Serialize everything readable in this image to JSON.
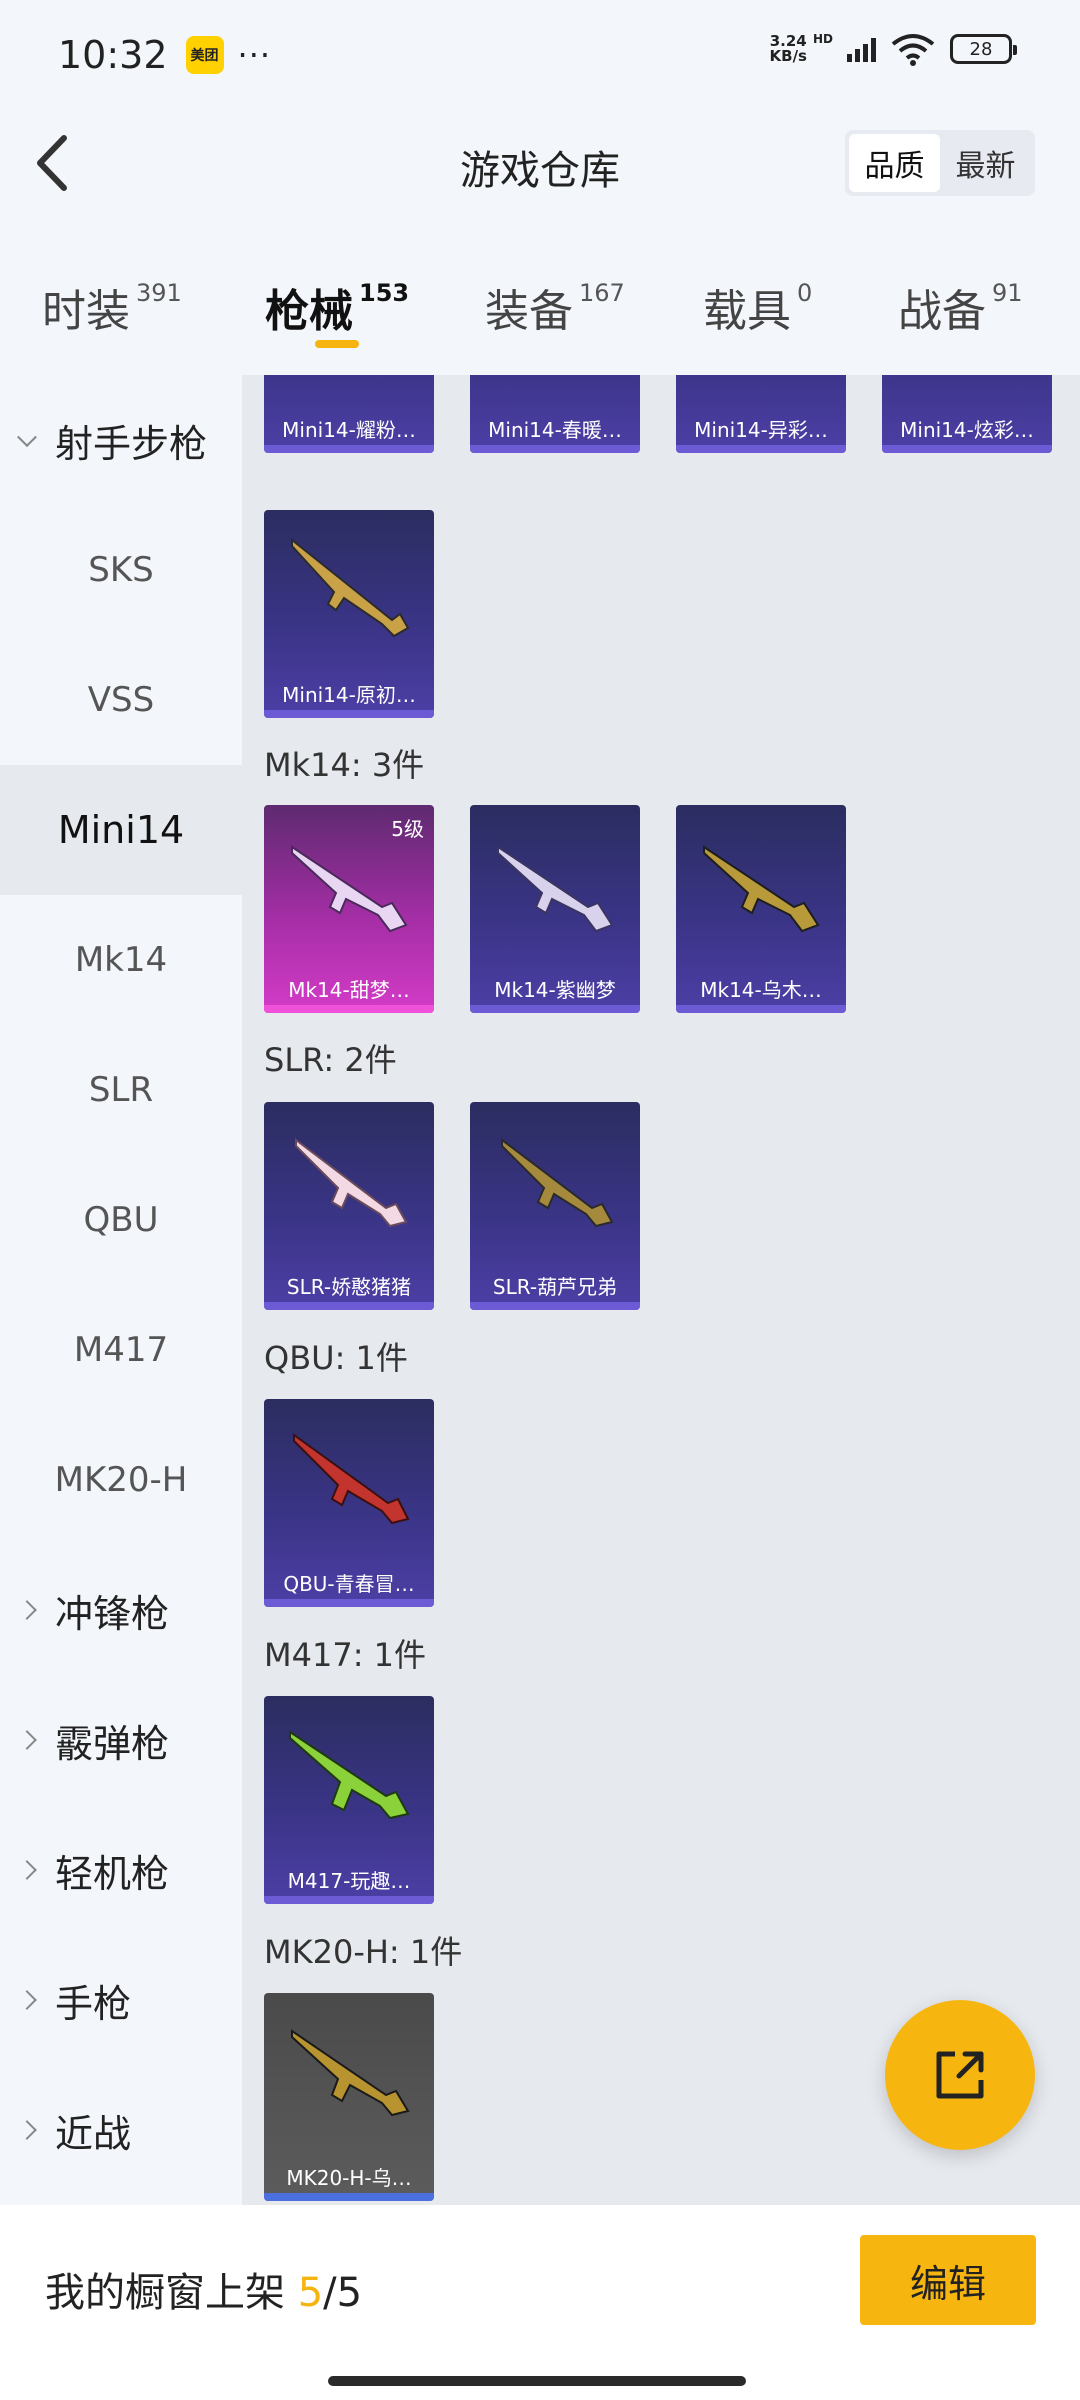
{
  "status": {
    "time": "10:32",
    "app_badge": "美团",
    "dots": "···",
    "net_speed_top": "3.24",
    "net_speed_bottom": "KB/s",
    "hd": "HD",
    "battery": "28"
  },
  "header": {
    "title": "游戏仓库",
    "sort_options": [
      "品质",
      "最新"
    ]
  },
  "tabs": [
    {
      "label": "时装",
      "count": "391"
    },
    {
      "label": "枪械",
      "count": "153"
    },
    {
      "label": "装备",
      "count": "167"
    },
    {
      "label": "载具",
      "count": "0"
    },
    {
      "label": "战备",
      "count": "91"
    }
  ],
  "sidebar": {
    "group_open": "射手步枪",
    "items": [
      "SKS",
      "VSS",
      "Mini14",
      "Mk14",
      "SLR",
      "QBU",
      "M417",
      "MK20-H"
    ],
    "groups": [
      "冲锋枪",
      "霰弹枪",
      "轻机枪",
      "手枪",
      "近战"
    ]
  },
  "sections": [
    {
      "header": "",
      "cards": [
        "Mini14-耀粉…",
        "Mini14-春暖…",
        "Mini14-异彩…",
        "Mini14-炫彩…",
        "Mini14-原初…"
      ]
    },
    {
      "header": "Mk14: 3件",
      "cards": [
        "Mk14-甜梦…",
        "Mk14-紫幽梦",
        "Mk14-乌木…"
      ],
      "level": "5级"
    },
    {
      "header": "SLR: 2件",
      "cards": [
        "SLR-娇憨猪猪",
        "SLR-葫芦兄弟"
      ]
    },
    {
      "header": "QBU: 1件",
      "cards": [
        "QBU-青春冒…"
      ]
    },
    {
      "header": "M417: 1件",
      "cards": [
        "M417-玩趣…"
      ]
    },
    {
      "header": "MK20-H: 1件",
      "cards": [
        "MK20-H-乌…"
      ]
    }
  ],
  "bottom": {
    "label": "我的橱窗上架 ",
    "current": "5",
    "total": "/5",
    "edit": "编辑"
  },
  "colors": {
    "accent": "#f7b50f",
    "card_purple": "#3a3486",
    "card_pink": "#d43bc8"
  }
}
